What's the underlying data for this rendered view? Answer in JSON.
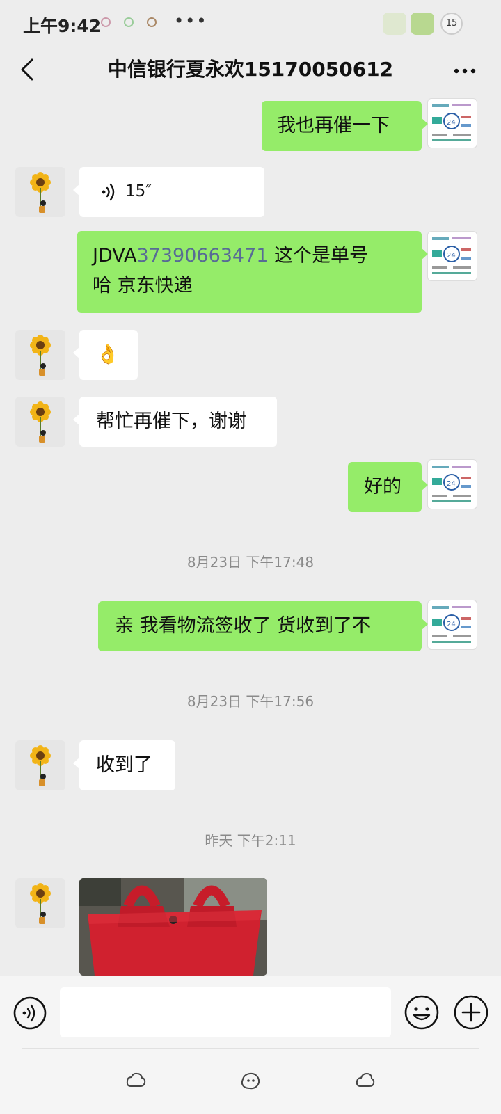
{
  "status_bar": {
    "time": "上午9:42",
    "more": "•••",
    "badge_count": "15"
  },
  "header": {
    "title": "中信银行夏永欢15170050612"
  },
  "messages": [
    {
      "sender": "self",
      "text": "我也再催一下"
    },
    {
      "sender": "other",
      "type": "voice",
      "duration": "15″"
    },
    {
      "sender": "self",
      "prefix": "JDVA",
      "number": "37390663471",
      "suffix": " 这个是单号",
      "line2": "哈 京东快递"
    },
    {
      "sender": "other",
      "type": "emoji",
      "text": "👌"
    },
    {
      "sender": "other",
      "text": "帮忙再催下，谢谢"
    },
    {
      "sender": "self",
      "text": "好的"
    },
    {
      "sender": "self",
      "text": "亲 我看物流签收了 货收到了不"
    },
    {
      "sender": "other",
      "text": "收到了"
    },
    {
      "sender": "other",
      "type": "image",
      "description": "red felt tote bag"
    }
  ],
  "timestamps": [
    "8月23日 下午17:48",
    "8月23日 下午17:56",
    "昨天 下午2:11"
  ],
  "colors": {
    "background": "#ededed",
    "outgoing_bubble": "#95ec69",
    "incoming_bubble": "#ffffff",
    "link": "#576b95",
    "timestamp": "#8a8a8a"
  },
  "icons": {
    "back": "chevron-left-icon",
    "more": "more-dots-icon",
    "voice_input": "voice-input-icon",
    "emoji": "emoji-icon",
    "add": "plus-circle-icon"
  }
}
